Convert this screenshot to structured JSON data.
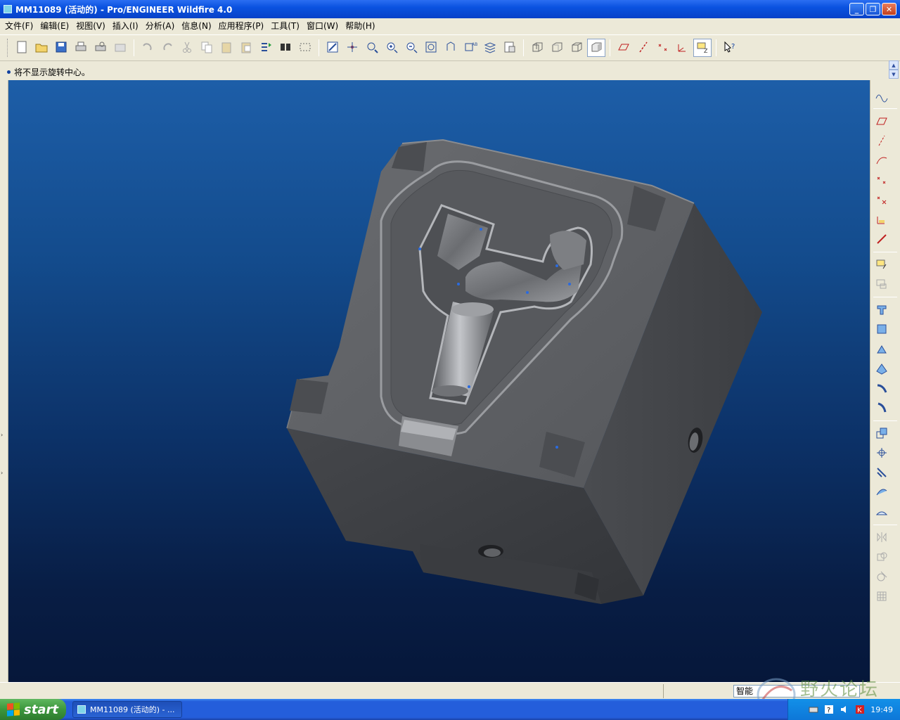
{
  "window": {
    "title": "MM11089 (活动的) - Pro/ENGINEER Wildfire 4.0",
    "minimize_icon": "minimize-icon",
    "maximize_icon": "restore-icon",
    "close_icon": "close-icon"
  },
  "menu": {
    "items": [
      {
        "label": "文件(F)"
      },
      {
        "label": "编辑(E)"
      },
      {
        "label": "视图(V)"
      },
      {
        "label": "插入(I)"
      },
      {
        "label": "分析(A)"
      },
      {
        "label": "信息(N)"
      },
      {
        "label": "应用程序(P)"
      },
      {
        "label": "工具(T)"
      },
      {
        "label": "窗口(W)"
      },
      {
        "label": "帮助(H)"
      }
    ]
  },
  "toolbar": {
    "groups": [
      [
        "new-icon",
        "open-icon",
        "save-icon",
        "print-icon",
        "print-preview-icon",
        "send-icon"
      ],
      [
        "undo-icon",
        "redo-icon",
        "cut-icon",
        "copy-icon",
        "paste-icon",
        "paste-special-icon",
        "regenerate-icon",
        "find-icon",
        "select-box-icon"
      ],
      [
        "repaint-icon",
        "spin-center-icon",
        "orient-icon",
        "zoom-in-icon",
        "zoom-out-icon",
        "refit-icon",
        "reorient-icon",
        "saved-views-icon",
        "layers-icon",
        "view-manager-icon"
      ],
      [
        "wireframe-icon",
        "hidden-line-icon",
        "no-hidden-icon",
        "shading-icon"
      ],
      [
        "datum-planes-icon",
        "datum-axes-icon",
        "datum-points-icon",
        "coordinate-systems-icon",
        "annotations-icon"
      ],
      [
        "context-help-icon"
      ]
    ],
    "active": [
      "shading-icon",
      "annotations-icon"
    ]
  },
  "message": {
    "text": "将不显示旋转中心。"
  },
  "right_toolbar": {
    "groups": [
      [
        "sketch-curve-icon"
      ],
      [
        "datum-plane-icon",
        "datum-axis-icon",
        "datum-curve-icon",
        "datum-point-icon",
        "offset-point-icon",
        "csys-icon",
        "analysis-icon"
      ],
      [
        "sketch-tool-icon",
        "sketch-tool-2-icon"
      ],
      [
        "extrude-icon",
        "revolve-icon",
        "variable-section-sweep-icon",
        "boundary-blend-icon",
        "hole-icon",
        "round-icon"
      ],
      [
        "chamfer-icon",
        "shell-icon",
        "rib-icon",
        "draft-icon",
        "offset-surface-icon"
      ],
      [
        "mirror-icon",
        "merge-icon",
        "trim-icon",
        "pattern-icon"
      ]
    ]
  },
  "status": {
    "filter_value": "智能"
  },
  "watermark": {
    "text": "野火论坛"
  },
  "taskbar": {
    "start_label": "start",
    "task_label": "MM11089 (活动的) - ...",
    "clock": "19:49"
  },
  "colors": {
    "viewport_top": "#1d5ea8",
    "viewport_bottom": "#06173a",
    "model_top_face": "#5c5e62",
    "model_left_face": "#3d3f43",
    "model_right_face": "#46484c"
  }
}
